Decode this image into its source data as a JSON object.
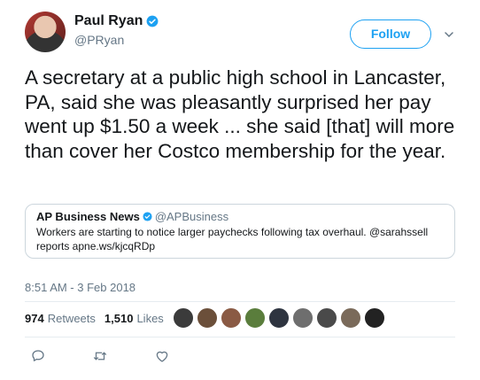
{
  "author": {
    "name": "Paul Ryan",
    "handle": "@PRyan"
  },
  "follow_label": "Follow",
  "tweet_text": "A secretary at a public high school in Lancaster, PA, said she was pleasantly surprised her pay went up $1.50 a week ... she said [that] will more than cover her Costco membership for the year.",
  "quoted": {
    "name": "AP Business News",
    "handle": "@APBusiness",
    "text": "Workers are starting to notice larger paychecks following tax overhaul. @sarahssell reports apne.ws/kjcqRDp"
  },
  "timestamp": "8:51 AM - 3 Feb 2018",
  "stats": {
    "retweets_count": "974",
    "retweets_label": "Retweets",
    "likes_count": "1,510",
    "likes_label": "Likes"
  },
  "icons": {
    "verified": "verified-badge-icon",
    "chevron": "chevron-down-icon",
    "reply": "reply-icon",
    "retweet": "retweet-icon",
    "like": "heart-icon"
  },
  "colors": {
    "accent": "#1da1f2",
    "muted": "#657786",
    "border": "#ccd6dd"
  }
}
